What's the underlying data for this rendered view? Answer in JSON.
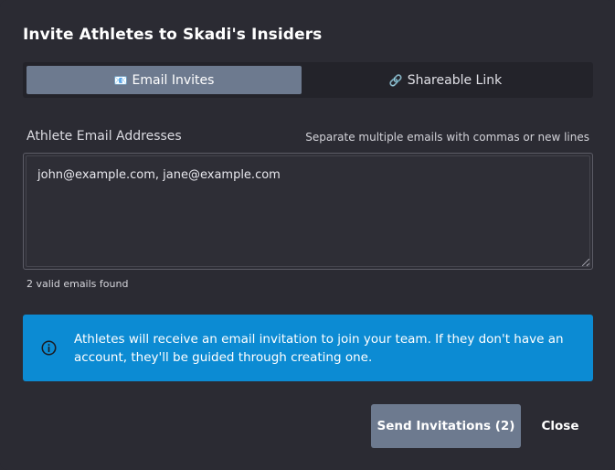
{
  "dialog": {
    "title": "Invite Athletes to Skadi's Insiders"
  },
  "tabs": [
    {
      "label": "Email Invites",
      "icon": "📧",
      "icon_name": "envelope-icon",
      "active": true
    },
    {
      "label": "Shareable Link",
      "icon": "🔗",
      "icon_name": "link-icon",
      "active": false
    }
  ],
  "email_field": {
    "label": "Athlete Email Addresses",
    "hint": "Separate multiple emails with commas or new lines",
    "value": "john@example.com, jane@example.com",
    "validation": "2 valid emails found"
  },
  "info": {
    "icon_name": "info-icon",
    "text": "Athletes will receive an email invitation to join your team. If they don't have an account, they'll be guided through creating one."
  },
  "actions": {
    "send_label": "Send Invitations (2)",
    "close_label": "Close"
  },
  "colors": {
    "background": "#2b2b33",
    "accent": "#6d7a8f",
    "info": "#0c8bd3"
  }
}
